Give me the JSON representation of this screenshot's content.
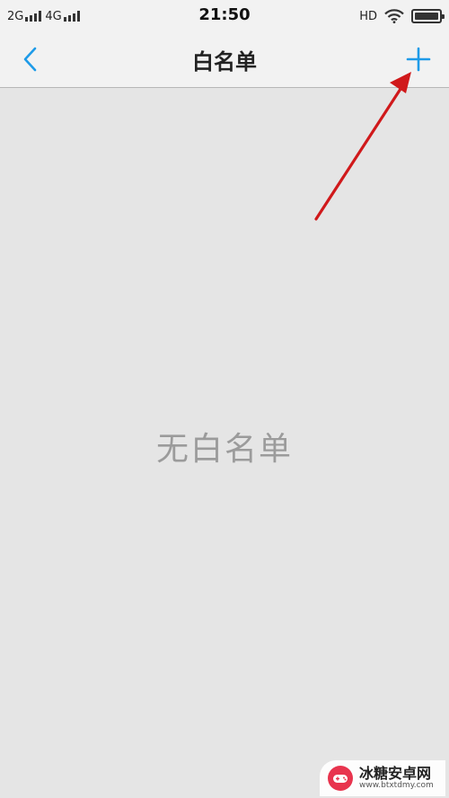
{
  "status_bar": {
    "network_1": "2G",
    "network_2": "4G",
    "time": "21:50",
    "hd": "HD",
    "battery_level": 1.0
  },
  "nav": {
    "title": "白名单",
    "back_icon": "chevron-left-icon",
    "add_icon": "plus-icon",
    "accent_color": "#1e9be8"
  },
  "content": {
    "empty_text": "无白名单"
  },
  "annotation": {
    "arrow_color": "#d0191b"
  },
  "watermark": {
    "name": "冰糖安卓网",
    "url": "www.btxtdmy.com",
    "logo_color": "#e8344e"
  }
}
